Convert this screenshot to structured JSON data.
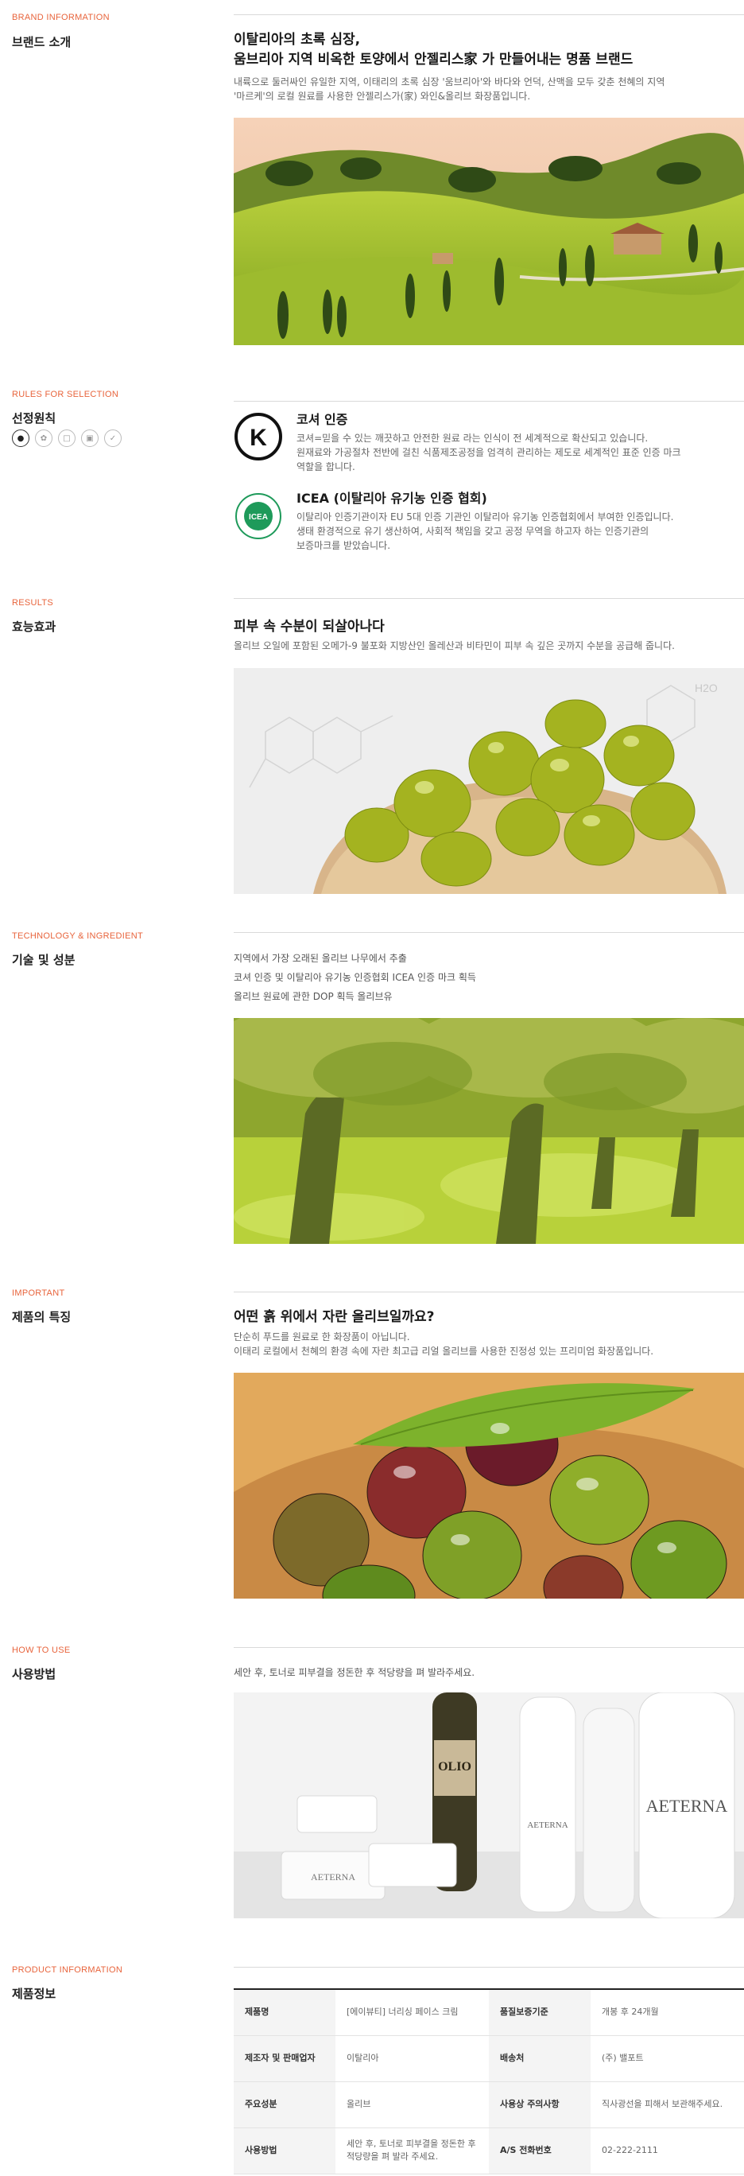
{
  "brand": {
    "label": "BRAND INFORMATION",
    "title": "브랜드 소개",
    "headline1": "이탈리아의 초록 심장,",
    "headline2": "움브리아 지역 비옥한 토양에서 안젤리스家 가 만들어내는 명품 브랜드",
    "desc1": "내륙으로 둘러싸인 유일한 지역, 이태리의 초록 심장 '움브리아'와 바다와 언덕, 산맥을 모두 갖춘 천혜의 지역",
    "desc2": "'마르케'의 로컬 원료를 사용한 안젤리스가(家) 와인&올리브 화장품입니다."
  },
  "rules": {
    "label": "RULES FOR SELECTION",
    "title": "선정원칙",
    "icons": [
      "drop-icon",
      "leaf-icon",
      "document-icon",
      "box-icon",
      "check-icon"
    ],
    "cert1": {
      "logo_letter": "K",
      "title": "코셔 인증",
      "line1": "코셔=믿을 수 있는 깨끗하고 안전한 원료 라는 인식이 전 세계적으로 확산되고 있습니다.",
      "line2": "원재료와 가공절차 전반에 걸친 식품제조공정을 엄격히 관리하는 제도로 세계적인 표준 인증 마크",
      "line3": "역할을 합니다."
    },
    "cert2": {
      "logo_letters": "ICEA",
      "title": "ICEA (이탈리아 유기농 인증 협회)",
      "line1": "이탈리아 인증기관이자 EU 5대 인증 기관인 이탈리아 유기농 인증협회에서 부여한 인증입니다.",
      "line2": "생태 환경적으로 유기 생산하여, 사회적 책임을 갖고 공정 무역을 하고자 하는 인증기관의",
      "line3": "보증마크를 받았습니다."
    }
  },
  "results": {
    "label": "RESULTS",
    "title": "효능효과",
    "headline": "피부 속 수분이 되살아나다",
    "desc": "올리브 오일에 포함된 오메가-9 불포화 지방산인 올레산과 비타민이 피부 속 깊은 곳까지 수분을 공급해 줍니다.",
    "molecule_label": "H2O"
  },
  "tech": {
    "label": "TECHNOLOGY & INGREDIENT",
    "title": "기술 및 성분",
    "lines": [
      "지역에서 가장 오래된 올리브 나무에서 추출",
      "코셔 인증 및 이탈리아 유기농 인증협회 ICEA 인증 마크 획득",
      "올리브 원료에 관한 DOP 획득 올리브유"
    ]
  },
  "important": {
    "label": "IMPORTANT",
    "title": "제품의 특징",
    "headline": "어떤 흙 위에서 자란 올리브일까요?",
    "desc1": "단순히 푸드를 원료로 한 화장품이 아닙니다.",
    "desc2": "이태리 로컬에서 천혜의 환경 속에 자란 최고급 리얼 올리브를 사용한 진정성 있는 프리미엄 화장품입니다."
  },
  "howto": {
    "label": "HOW TO USE",
    "title": "사용방법",
    "desc": "세안 후, 토너로 피부결을 정돈한 후 적당량을 펴 발라주세요.",
    "bottle_brand": "OLIO",
    "product_name": "AETERNA"
  },
  "product": {
    "label": "PRODUCT INFORMATION",
    "title": "제품정보",
    "rows": [
      [
        "제품명",
        "[에이뷰티] 너리싱 페이스 크림",
        "품질보증기준",
        "개봉 후 24개월"
      ],
      [
        "제조자 및 판매업자",
        "이탈리아",
        "배송처",
        "(주) 밸포트"
      ],
      [
        "주요성분",
        "올리브",
        "사용상 주의사항",
        "직사광선을 피해서 보관해주세요."
      ],
      [
        "사용방법",
        "세안 후, 토너로 피부결을 정돈한 후 적당량을 펴 발라 주세요.",
        "A/S 전화번호",
        "02-222-2111"
      ]
    ]
  },
  "colors": {
    "accent": "#e8643c",
    "rule": "#d9d9d9",
    "cert_green": "#1e9a5a"
  }
}
